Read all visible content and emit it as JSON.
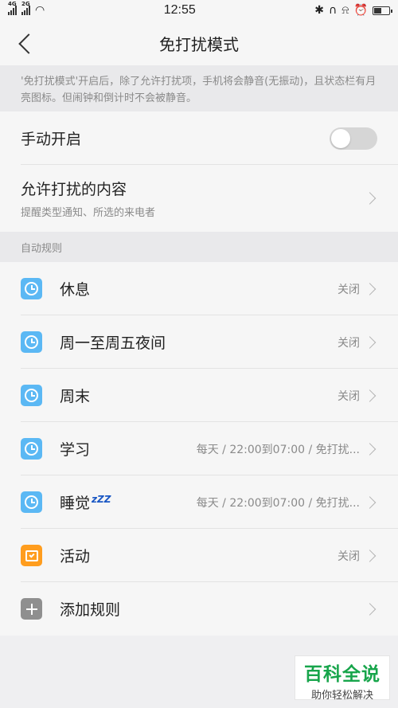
{
  "status_bar": {
    "time": "12:55",
    "signal1": "4G",
    "signal2": "2G",
    "icons": [
      "bluetooth-icon",
      "headset-icon",
      "bell-off-icon",
      "alarm-icon",
      "battery-icon"
    ]
  },
  "header": {
    "title": "免打扰模式"
  },
  "note": "'免打扰模式'开启后，除了允许打扰项，手机将会静音(无振动)，且状态栏有月亮图标。但闹钟和倒计时不会被静音。",
  "manual": {
    "label": "手动开启",
    "enabled": false
  },
  "allowed": {
    "label": "允许打扰的内容",
    "sub": "提醒类型通知、所选的来电者"
  },
  "section_label": "自动规则",
  "rules": [
    {
      "label": "休息",
      "status": "关闭",
      "icon": "clock-icon"
    },
    {
      "label": "周一至周五夜间",
      "status": "关闭",
      "icon": "clock-icon"
    },
    {
      "label": "周末",
      "status": "关闭",
      "icon": "clock-icon"
    },
    {
      "label": "学习",
      "status": "每天 / 22:00到07:00 / 免打扰...",
      "icon": "clock-icon"
    },
    {
      "label": "睡觉",
      "extra": "zZZ",
      "status": "每天 / 22:00到07:00 / 免打扰...",
      "icon": "clock-icon"
    },
    {
      "label": "活动",
      "status": "关闭",
      "icon": "calendar-icon"
    }
  ],
  "add_rule": {
    "label": "添加规则",
    "icon": "plus-icon"
  },
  "watermark": {
    "title": "百科全说",
    "sub": "助你轻松解决"
  },
  "colors": {
    "clock_icon": "#5bb8f4",
    "event_icon": "#ff9d1e",
    "add_icon": "#8f8f8f",
    "watermark": "#17a54b"
  }
}
